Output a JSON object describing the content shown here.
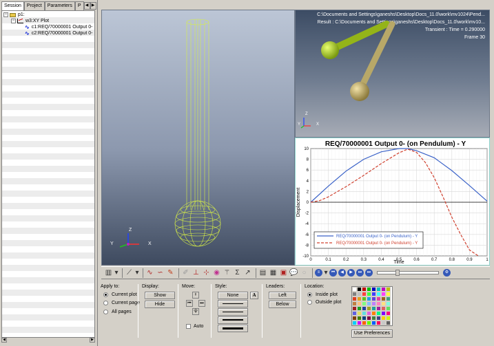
{
  "browser": {
    "tabs": [
      "Session",
      "Project",
      "Parameters",
      "P"
    ],
    "tree": {
      "page": "p1:",
      "plot": "w3:XY Plot",
      "curves": [
        "c1:REQ/70000001 Output 0-",
        "c2:REQ/70000001 Output 0-"
      ]
    }
  },
  "viewport": {
    "triad": {
      "x": "X",
      "y": "Y",
      "z": "Z"
    }
  },
  "animation_window": {
    "path_line": "C:\\Documents and Settings\\ganeshs\\Desktop\\Docs_11.0\\work\\mv1024\\Pend...",
    "result_line": "Result :  C:\\Documents and Settings\\ganeshs\\Desktop\\Docs_11.0\\work\\mv10...",
    "transient_line": "Transient : Time = 0.290000",
    "frame_line": "Frame 30",
    "triad": {
      "x": "X",
      "y": "Y",
      "z": "Z"
    }
  },
  "chart_data": {
    "type": "line",
    "title": "REQ/70000001 Output 0- (on Pendulum) - Y",
    "xlabel": "Time",
    "ylabel": "Displacement",
    "xlim": [
      0,
      1
    ],
    "ylim": [
      -10,
      10
    ],
    "x_ticks": [
      "0",
      "0.1",
      "0.2",
      "0.3",
      "0.4",
      "0.5",
      "0.6",
      "0.7",
      "0.8",
      "0.9",
      "1"
    ],
    "y_ticks": [
      "10",
      "8",
      "6",
      "4",
      "2",
      "0",
      "-2",
      "-4",
      "-6",
      "-8",
      "-10"
    ],
    "grid": true,
    "legend_position": "bottom-left",
    "series": [
      {
        "name": "REQ/70000001 Output 0- (on Pendulum) - Y",
        "color": "#3a62c8",
        "style": "solid",
        "x": [
          0,
          0.1,
          0.2,
          0.3,
          0.4,
          0.5,
          0.55,
          0.6,
          0.7,
          0.8,
          0.9,
          1.0
        ],
        "y": [
          0,
          3.0,
          5.8,
          8.0,
          9.4,
          10.0,
          10.0,
          9.6,
          8.3,
          5.9,
          3.1,
          0.2
        ]
      },
      {
        "name": "REQ/70000001 Output 0- (on Pendulum) - Y",
        "color": "#d0402e",
        "style": "dashed",
        "x": [
          0,
          0.05,
          0.1,
          0.2,
          0.3,
          0.4,
          0.5,
          0.55,
          0.6,
          0.65,
          0.7,
          0.75,
          0.8,
          0.85,
          0.9,
          0.95
        ],
        "y": [
          0,
          0.3,
          1.0,
          2.9,
          5.0,
          7.2,
          9.2,
          9.9,
          9.3,
          7.4,
          4.6,
          1.0,
          -2.8,
          -6.0,
          -8.9,
          -10.0
        ]
      }
    ]
  },
  "panel": {
    "apply_to": {
      "title": "Apply to:",
      "options": [
        "Current plot",
        "Current page",
        "All pages"
      ],
      "selected": "Current plot"
    },
    "display": {
      "title": "Display:",
      "show": "Show",
      "hide": "Hide"
    },
    "move": {
      "title": "Move:",
      "auto": "Auto"
    },
    "style": {
      "title": "Style:",
      "none": "None",
      "font_btn": "A"
    },
    "leaders": {
      "title": "Leaders:",
      "left": "Left",
      "below": "Below"
    },
    "location": {
      "title": "Location:",
      "options": [
        "Inside plot",
        "Outside plot"
      ],
      "selected": "Inside plot"
    },
    "use_preferences": "Use Preferences",
    "palette": [
      "#ffffff",
      "#000000",
      "#c00000",
      "#00c000",
      "#0000c0",
      "#00c0c0",
      "#c000c0",
      "#c0c000",
      "#808080",
      "#c0c0c0",
      "#ff4040",
      "#40ff40",
      "#4040ff",
      "#40ffff",
      "#ff40ff",
      "#ffff40",
      "#e04020",
      "#e0a020",
      "#60c020",
      "#20a0e0",
      "#6040e0",
      "#e040a0",
      "#a06020",
      "#40a080",
      "#c08040",
      "#ffc080",
      "#80ff80",
      "#80c0ff",
      "#c080ff",
      "#ff80c0",
      "#ffe080",
      "#80ffe0",
      "#a02020",
      "#20a020",
      "#2040a0",
      "#a0a020",
      "#20a0a0",
      "#a020a0",
      "#e06060",
      "#60e060",
      "#6060e0",
      "#e0e060",
      "#60e0e0",
      "#e060e0",
      "#ff8000",
      "#00ff80",
      "#8000ff",
      "#ff0080",
      "#804000",
      "#408000",
      "#004080",
      "#800040",
      "#408040",
      "#404080",
      "#ffd000",
      "#d0ff00",
      "#00d0ff",
      "#d000ff",
      "#ff6000",
      "#60ff00",
      "#0060ff",
      "#ff0060",
      "#c8c8c8",
      "#606060"
    ]
  }
}
